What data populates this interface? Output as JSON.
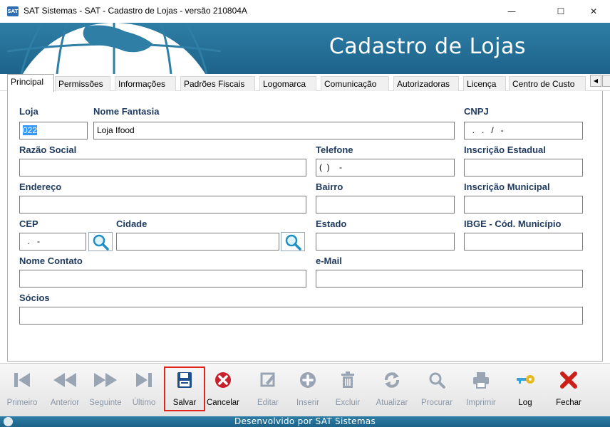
{
  "window": {
    "app_icon_text": "SAT",
    "title": "SAT Sistemas - SAT - Cadastro de Lojas - versão 210804A",
    "minimize": "—",
    "maximize": "☐",
    "close": "✕"
  },
  "banner": {
    "title": "Cadastro de Lojas",
    "bg_color": "#1d6289"
  },
  "tabs": [
    {
      "label": "Principal",
      "active": true
    },
    {
      "label": "Permissões"
    },
    {
      "label": "Informações"
    },
    {
      "label": "Padrões Fiscais"
    },
    {
      "label": "Logomarca"
    },
    {
      "label": "Comunicação"
    },
    {
      "label": "Autorizadoras"
    },
    {
      "label": "Licença"
    },
    {
      "label": "Centro de Custo"
    }
  ],
  "tab_scroll": {
    "left": "◀"
  },
  "form": {
    "loja": {
      "label": "Loja",
      "value": "022"
    },
    "nome_fantasia": {
      "label": "Nome Fantasia",
      "value": "Loja Ifood"
    },
    "cnpj": {
      "label": "CNPJ",
      "value": "  .   .   /   -"
    },
    "razao_social": {
      "label": "Razão Social",
      "value": ""
    },
    "telefone": {
      "label": "Telefone",
      "value": "(  )    -"
    },
    "inscricao_estadual": {
      "label": "Inscrição Estadual",
      "value": ""
    },
    "endereco": {
      "label": "Endereço",
      "value": ""
    },
    "bairro": {
      "label": "Bairro",
      "value": ""
    },
    "inscricao_municipal": {
      "label": "Inscrição Municipal",
      "value": ""
    },
    "cep": {
      "label": "CEP",
      "value": "  .   -"
    },
    "cidade": {
      "label": "Cidade",
      "value": ""
    },
    "estado": {
      "label": "Estado",
      "value": ""
    },
    "ibge": {
      "label": "IBGE - Cód. Município",
      "value": ""
    },
    "nome_contato": {
      "label": "Nome Contato",
      "value": ""
    },
    "email": {
      "label": "e-Mail",
      "value": ""
    },
    "socios": {
      "label": "Sócios",
      "value": ""
    }
  },
  "toolbar": {
    "primeiro": "Primeiro",
    "anterior": "Anterior",
    "seguinte": "Seguinte",
    "ultimo": "Último",
    "salvar": "Salvar",
    "cancelar": "Cancelar",
    "editar": "Editar",
    "inserir": "Inserir",
    "excluir": "Excluir",
    "atualizar": "Atualizar",
    "procurar": "Procurar",
    "imprimir": "Imprimir",
    "log": "Log",
    "fechar": "Fechar"
  },
  "status": {
    "text": "Desenvolvido por SAT Sistemas"
  },
  "colors": {
    "label": "#1f3a5f",
    "highlight": "#e2231a",
    "disabled_icon": "#9aa5b4",
    "save_icon": "#1f4e8c",
    "cancel_icon": "#c8202c",
    "close_icon": "#cc1f1a",
    "log_icon": "#e8b91a"
  }
}
